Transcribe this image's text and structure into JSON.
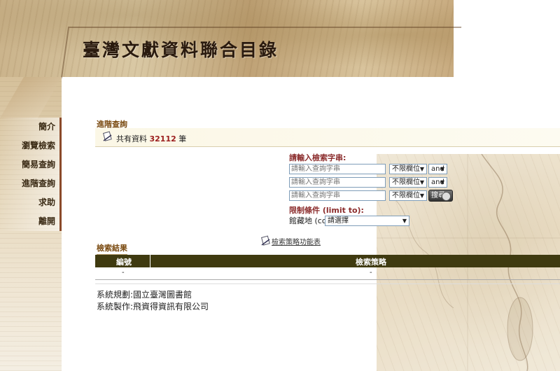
{
  "header": {
    "title": "臺灣文獻資料聯合目錄"
  },
  "nav": {
    "items": [
      "簡介",
      "瀏覽檢索",
      "簡易查詢",
      "進階查詢",
      "求助",
      "離開"
    ]
  },
  "advanced": {
    "title": "進階查詢",
    "count_prefix": "共有資料",
    "count_value": "32112",
    "count_suffix": "筆"
  },
  "form": {
    "prompt": "請輸入檢索字串:",
    "query_placeholder": "請輸入查詢字串",
    "field_value": "不限欄位",
    "bool_value": "and",
    "search_label": "搜尋",
    "limit_label": "限制條件 (limit to):",
    "location_label": "館藏地 (col)",
    "location_value": "請選擇"
  },
  "tips": {
    "label": "檢索策略功能表"
  },
  "results": {
    "title": "檢索結果",
    "columns": [
      "編號",
      "檢索策略"
    ],
    "rows": [
      [
        "-",
        "-"
      ]
    ]
  },
  "footer": {
    "line1": "系統規劃:國立臺灣圖書館",
    "line2": "系統製作:飛資得資訊有限公司"
  }
}
